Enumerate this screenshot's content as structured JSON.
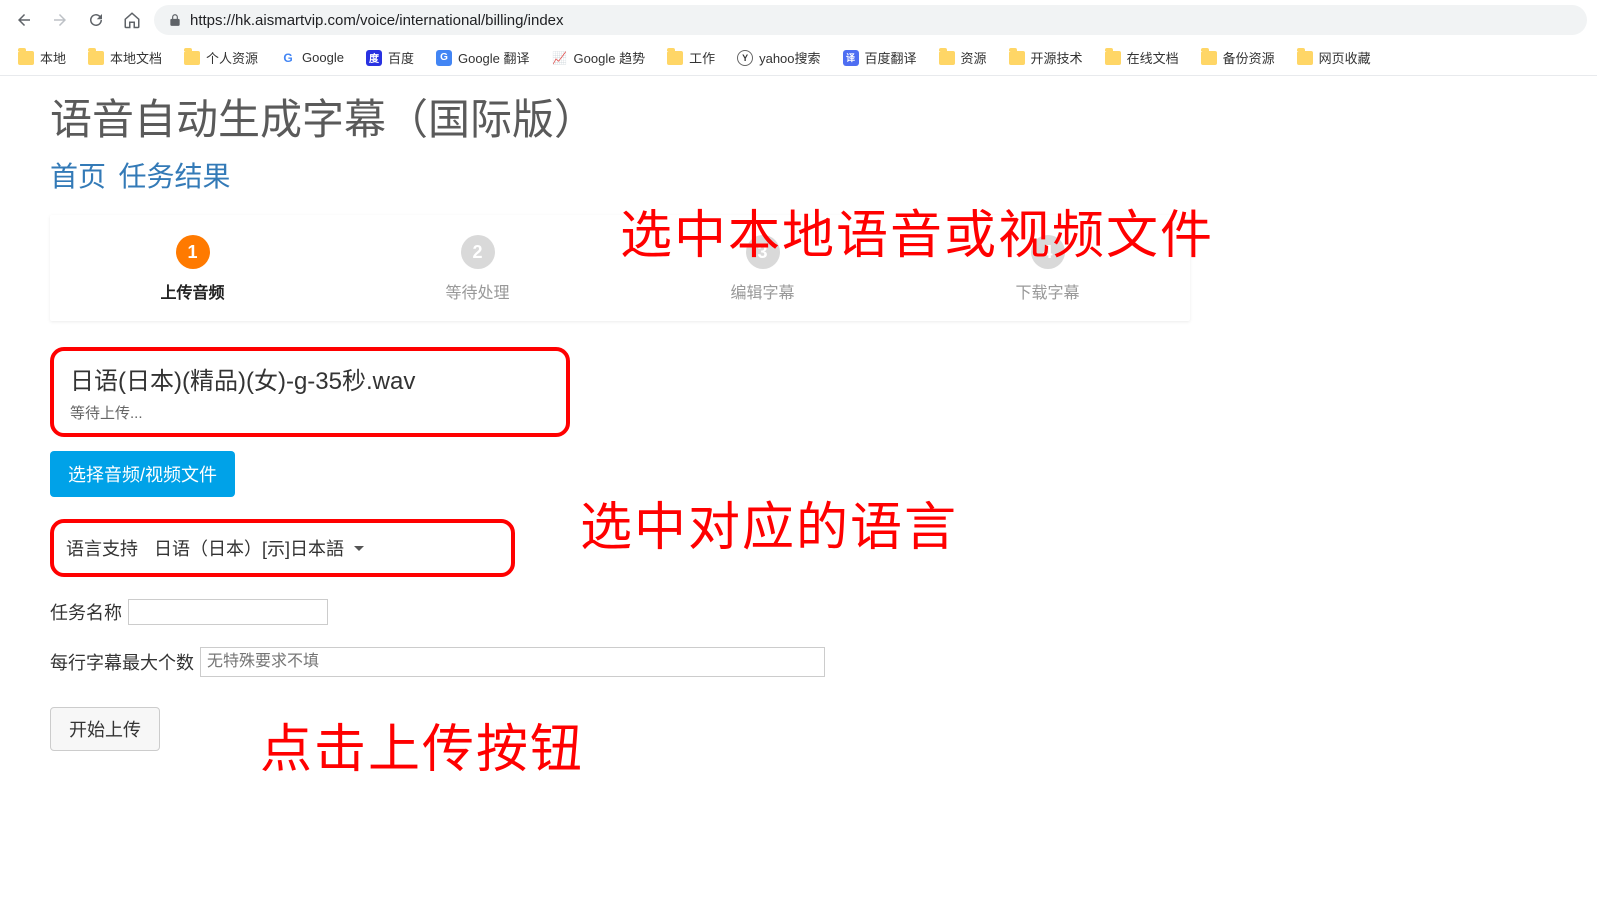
{
  "browser": {
    "url": "https://hk.aismartvip.com/voice/international/billing/index"
  },
  "bookmarks": [
    {
      "label": "本地",
      "type": "folder"
    },
    {
      "label": "本地文档",
      "type": "folder"
    },
    {
      "label": "个人资源",
      "type": "folder"
    },
    {
      "label": "Google",
      "type": "google"
    },
    {
      "label": "百度",
      "type": "baidu"
    },
    {
      "label": "Google 翻译",
      "type": "gtrans"
    },
    {
      "label": "Google 趋势",
      "type": "trend"
    },
    {
      "label": "工作",
      "type": "folder"
    },
    {
      "label": "yahoo搜索",
      "type": "yahoo"
    },
    {
      "label": "百度翻译",
      "type": "bdfy"
    },
    {
      "label": "资源",
      "type": "folder"
    },
    {
      "label": "开源技术",
      "type": "folder"
    },
    {
      "label": "在线文档",
      "type": "folder"
    },
    {
      "label": "备份资源",
      "type": "folder"
    },
    {
      "label": "网页收藏",
      "type": "folder"
    }
  ],
  "page": {
    "title": "语音自动生成字幕（国际版）",
    "breadcrumb": {
      "home": "首页",
      "results": "任务结果"
    },
    "steps": [
      {
        "num": "1",
        "label": "上传音频",
        "active": true
      },
      {
        "num": "2",
        "label": "等待处理",
        "active": false
      },
      {
        "num": "3",
        "label": "编辑字幕",
        "active": false
      },
      {
        "num": "4",
        "label": "下载字幕",
        "active": false
      }
    ],
    "file": {
      "name": "日语(日本)(精品)(女)-g-35秒.wav",
      "status": "等待上传..."
    },
    "buttons": {
      "select_file": "选择音频/视频文件",
      "start_upload": "开始上传"
    },
    "language": {
      "label": "语言支持",
      "value": "日语（日本）[示]日本語"
    },
    "task_name": {
      "label": "任务名称",
      "value": ""
    },
    "max_chars": {
      "label": "每行字幕最大个数",
      "placeholder": "无特殊要求不填"
    }
  },
  "annotations": {
    "a1": "选中本地语音或视频文件",
    "a2": "选中对应的语言",
    "a3": "点击上传按钮"
  }
}
